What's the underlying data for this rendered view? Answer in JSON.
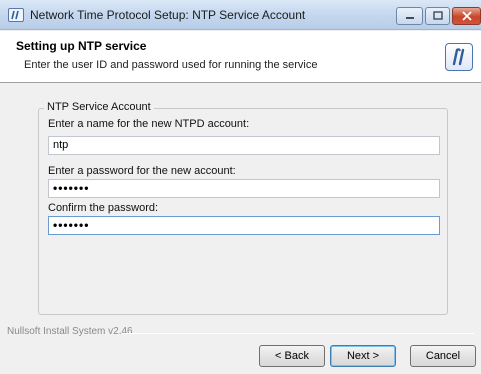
{
  "window": {
    "title": "Network Time Protocol Setup: NTP Service Account"
  },
  "header": {
    "title": "Setting up NTP service",
    "subtitle": "Enter the user ID and password used for running the service"
  },
  "group": {
    "legend": "NTP Service Account",
    "account_label": "Enter a name for the new NTPD account:",
    "account_value": "ntp",
    "password_label": "Enter a password for the new account:",
    "password_value": "•••••••",
    "confirm_label": "Confirm the password:",
    "confirm_value": "•••••••"
  },
  "footer": {
    "brand": "Nullsoft Install System v2.46",
    "back_label": "< Back",
    "next_label": "Next >",
    "cancel_label": "Cancel"
  }
}
